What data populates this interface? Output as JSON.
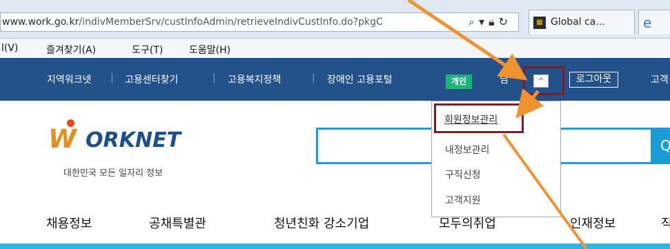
{
  "browser": {
    "url_domain": "www.work.go.kr",
    "url_path": "/indivMemberSrv/custInfoAdmin/retrieveIndivCustInfo.do?pkgC",
    "tab_title": "Global ca...",
    "menu": [
      "l(V)",
      "즐겨찾기(A)",
      "도구(T)",
      "도움말(H)"
    ]
  },
  "topnav": {
    "links": [
      "지역워크넷",
      "고용센터찾기",
      "고용복지정책",
      "장애인 고용포털"
    ],
    "badge": "개인",
    "user_suffix": "님",
    "expander": "^",
    "logout": "로그아웃",
    "support": "고객"
  },
  "header": {
    "logo_w": "W",
    "logo_text": "ORKNET",
    "tagline": "대한민국 모든 일자리 정보",
    "search_icon": "Q"
  },
  "dropdown": {
    "items": [
      "회원정보관리",
      "내정보관리",
      "구직신청",
      "고객지원"
    ]
  },
  "mainnav": {
    "items": [
      "채용정보",
      "공채특별관",
      "청년친화 강소기업",
      "모두의취업",
      "인재정보",
      "직"
    ]
  },
  "colors": {
    "nav_bg": "#23528a",
    "highlight": "#7e1b26",
    "accent": "#1a9cd6",
    "arrow": "#f0922e"
  }
}
